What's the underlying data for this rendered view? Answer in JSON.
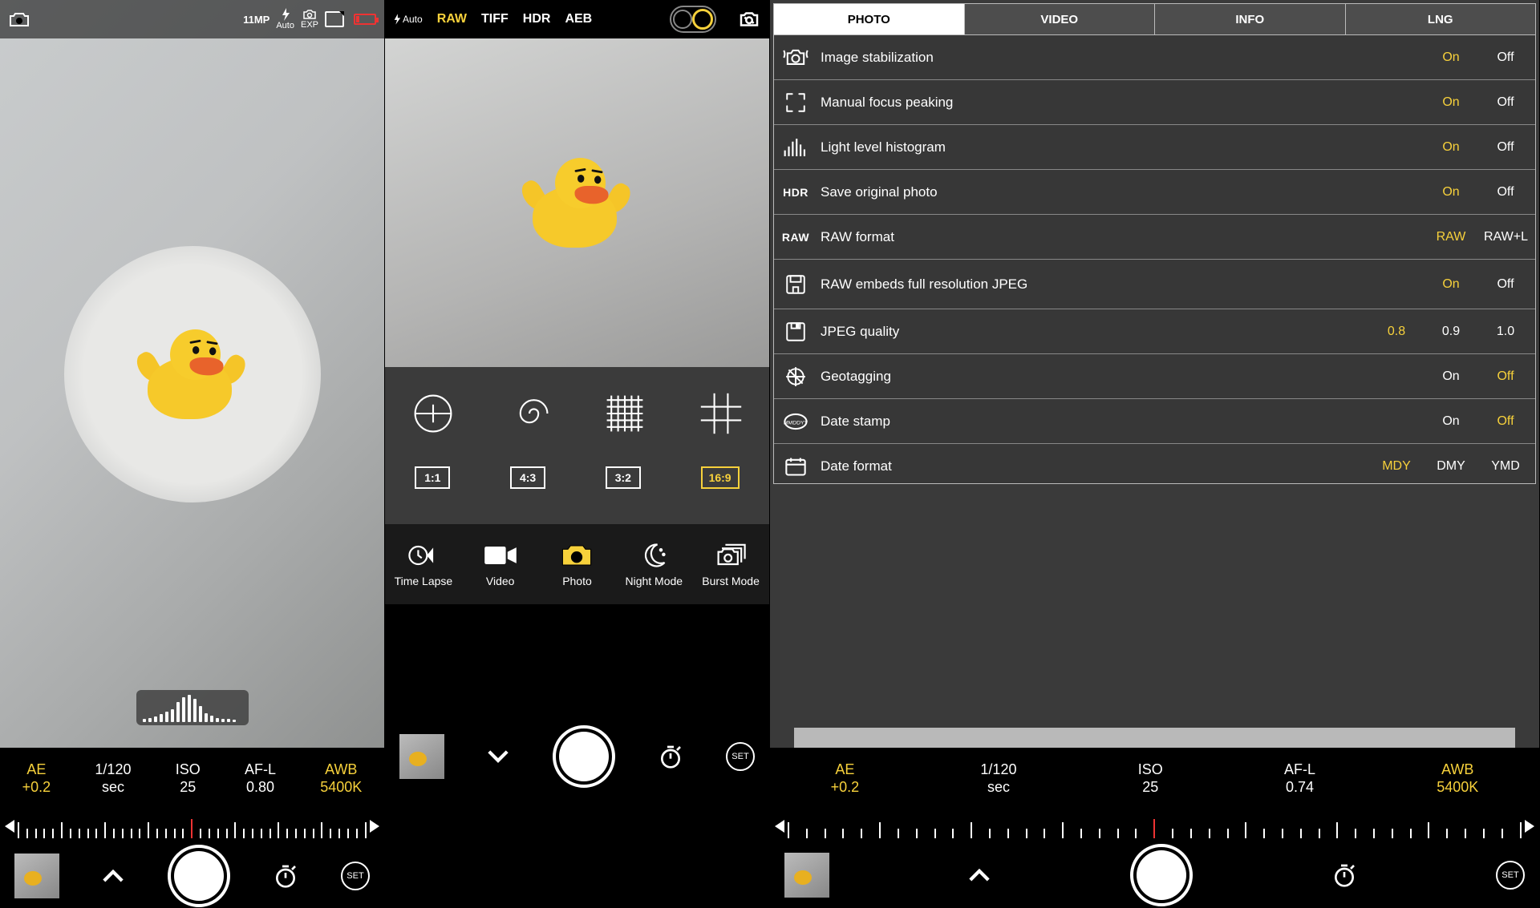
{
  "panel1": {
    "topbar": {
      "mp": "11MP",
      "flash": "Auto",
      "exp": "EXP"
    },
    "readout": {
      "ae_label": "AE",
      "ae_val": "+0.2",
      "shutter_val": "1/120",
      "shutter_unit": "sec",
      "iso_label": "ISO",
      "iso_val": "25",
      "af_label": "AF-L",
      "af_val": "0.80",
      "awb_label": "AWB",
      "awb_val": "5400K"
    },
    "set": "SET"
  },
  "panel2": {
    "flash": "Auto",
    "formats": [
      "RAW",
      "TIFF",
      "HDR",
      "AEB"
    ],
    "format_selected": 0,
    "ratios": [
      "1:1",
      "4:3",
      "3:2",
      "16:9"
    ],
    "ratio_selected": 3,
    "modes": [
      "Time Lapse",
      "Video",
      "Photo",
      "Night Mode",
      "Burst Mode"
    ],
    "mode_selected": 2,
    "set": "SET"
  },
  "panel3": {
    "tabs": [
      "PHOTO",
      "VIDEO",
      "INFO",
      "LNG"
    ],
    "tab_selected": 0,
    "rows": [
      {
        "icon": "stab",
        "label": "Image stabilization",
        "opts": [
          "On",
          "Off"
        ],
        "sel": 0
      },
      {
        "icon": "focuspeak",
        "label": "Manual focus peaking",
        "opts": [
          "On",
          "Off"
        ],
        "sel": 0
      },
      {
        "icon": "hist",
        "label": "Light level histogram",
        "opts": [
          "On",
          "Off"
        ],
        "sel": 0
      },
      {
        "iconText": "HDR",
        "label": "Save original photo",
        "opts": [
          "On",
          "Off"
        ],
        "sel": 0
      },
      {
        "iconText": "RAW",
        "label": "RAW format",
        "opts": [
          "RAW",
          "RAW+L"
        ],
        "sel": 0
      },
      {
        "icon": "save",
        "label": "RAW embeds full resolution JPEG",
        "opts": [
          "On",
          "Off"
        ],
        "sel": 0,
        "tall": true
      },
      {
        "icon": "disk",
        "label": "JPEG quality",
        "opts": [
          "0.8",
          "0.9",
          "1.0"
        ],
        "sel": 0
      },
      {
        "icon": "geo",
        "label": "Geotagging",
        "opts": [
          "On",
          "Off"
        ],
        "sel": 1
      },
      {
        "icon": "stamp",
        "label": "Date stamp",
        "opts": [
          "On",
          "Off"
        ],
        "sel": 1
      },
      {
        "icon": "cal",
        "label": "Date format",
        "opts": [
          "MDY",
          "DMY",
          "YMD"
        ],
        "sel": 0
      }
    ],
    "readout": {
      "ae_label": "AE",
      "ae_val": "+0.2",
      "shutter_val": "1/120",
      "shutter_unit": "sec",
      "iso_label": "ISO",
      "iso_val": "25",
      "af_label": "AF-L",
      "af_val": "0.74",
      "awb_label": "AWB",
      "awb_val": "5400K"
    },
    "set": "SET"
  }
}
